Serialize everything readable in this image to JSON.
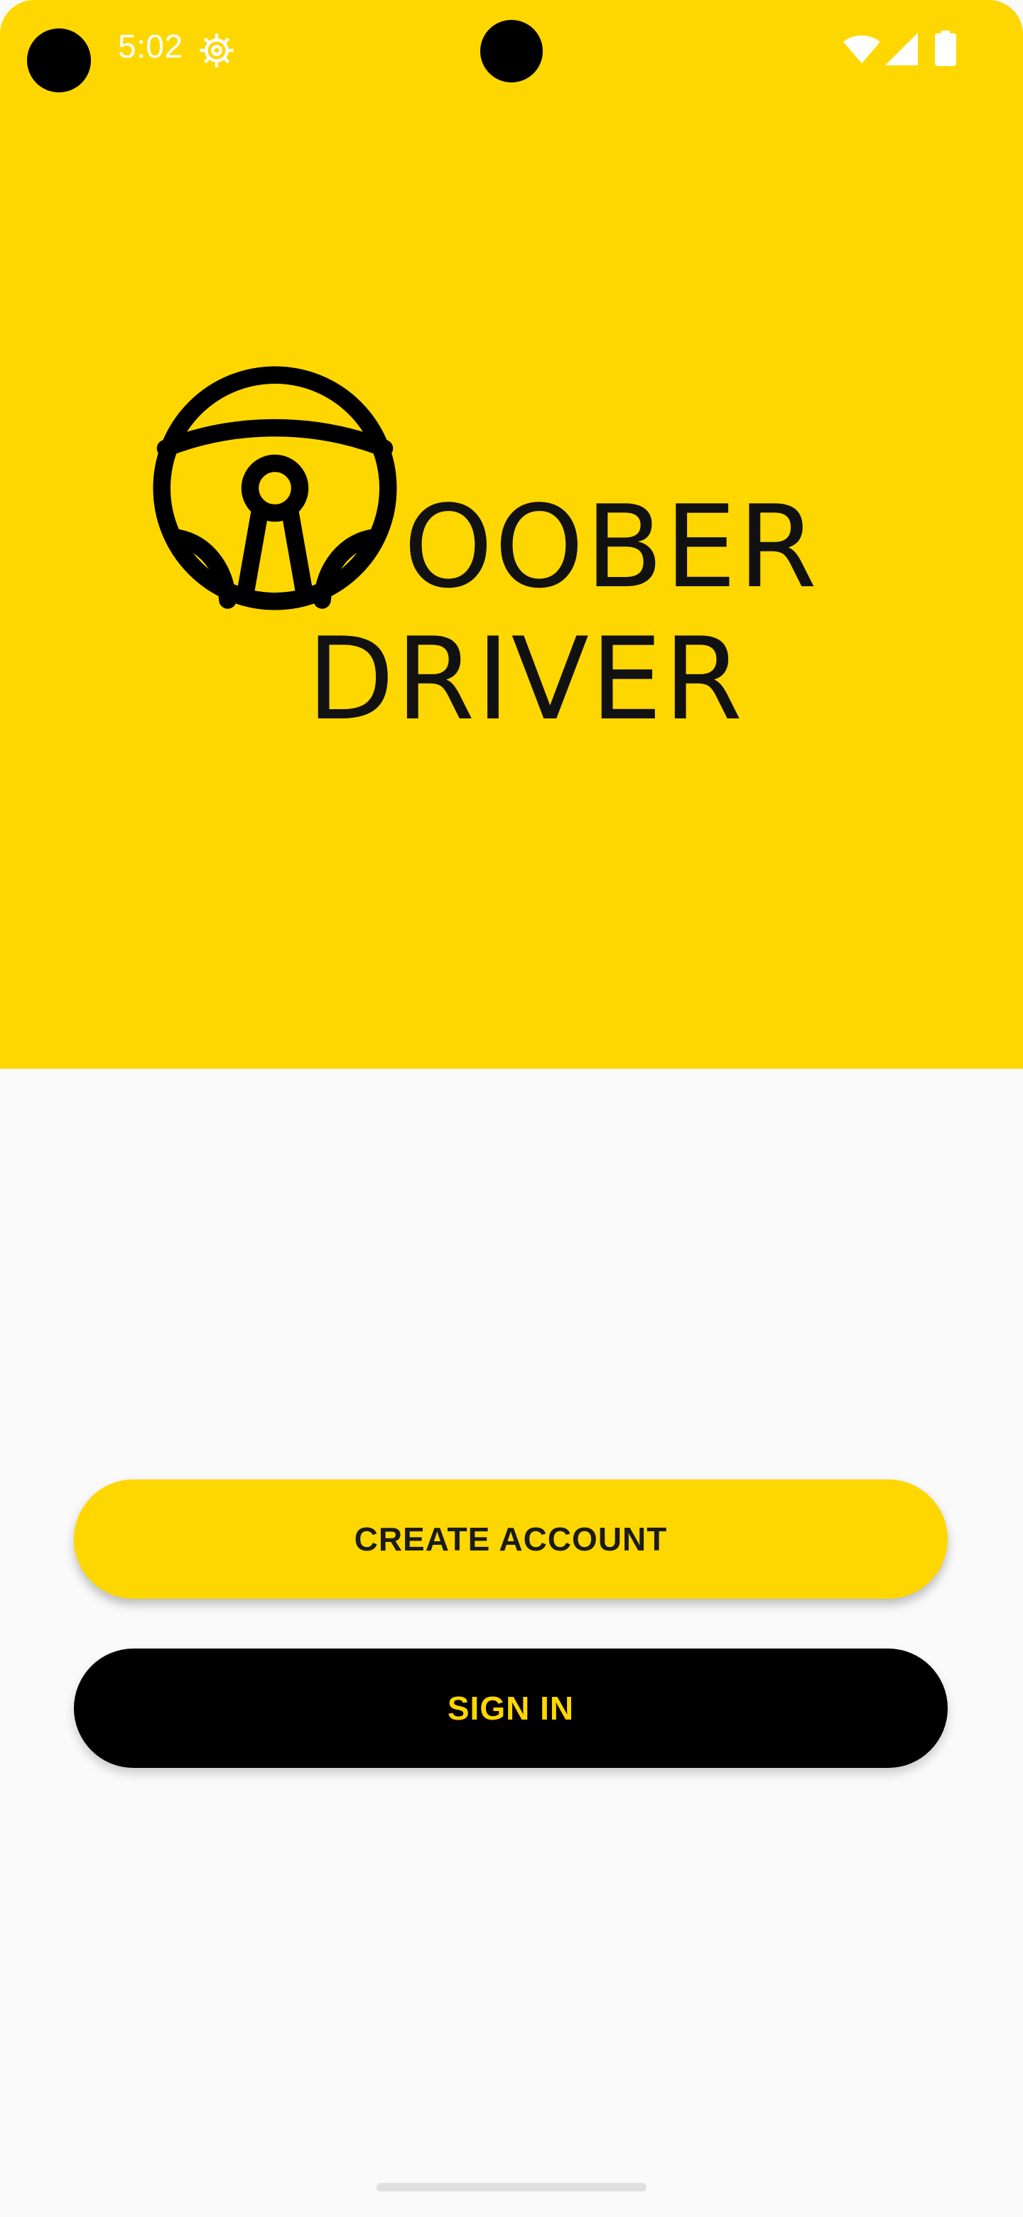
{
  "status_bar": {
    "time": "5:02",
    "icons": [
      "gear-icon",
      "wifi-icon",
      "signal-icon",
      "battery-icon"
    ]
  },
  "logo": {
    "line1": "OOBER",
    "line2": "DRIVER",
    "icon": "steering-wheel-icon"
  },
  "buttons": {
    "create_account": "CREATE ACCOUNT",
    "sign_in": "SIGN IN"
  },
  "colors": {
    "brand_yellow": "#FFD700",
    "black": "#000000",
    "background": "#FAFAFA"
  }
}
